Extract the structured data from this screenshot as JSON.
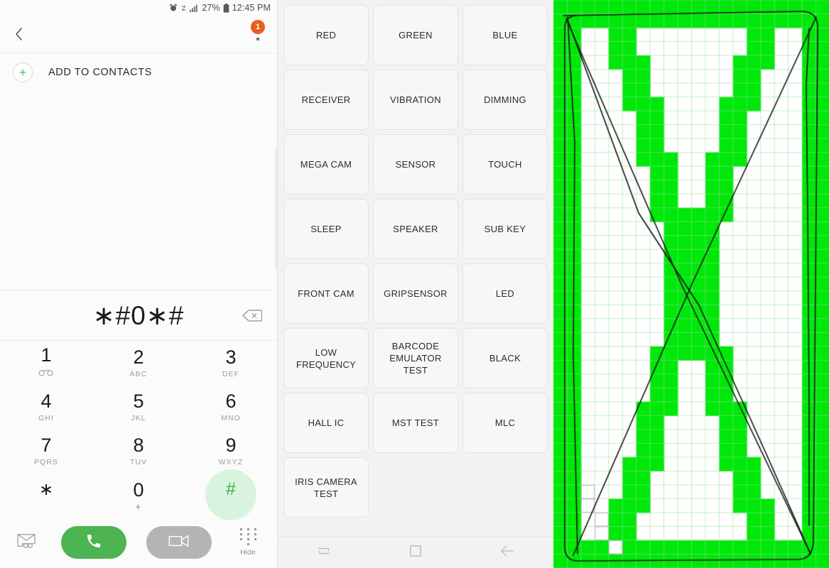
{
  "dialer": {
    "statusbar": {
      "icons": [
        "alarm-icon",
        "sync-icon",
        "signal-icon"
      ],
      "battery_percent": "27%",
      "battery_icon": "battery-icon",
      "time": "12:45 PM"
    },
    "appbar": {
      "back_icon": "chevron-left-icon",
      "badge_count": "1"
    },
    "add_to_contacts": {
      "icon": "plus-icon",
      "label": "ADD TO CONTACTS"
    },
    "number_display": {
      "value": "∗#0∗#",
      "backspace_icon": "backspace-icon"
    },
    "keypad": [
      {
        "digit": "1",
        "sub": "",
        "icon": "voicemail-icon",
        "pressed": false
      },
      {
        "digit": "2",
        "sub": "ABC",
        "icon": "",
        "pressed": false
      },
      {
        "digit": "3",
        "sub": "DEF",
        "icon": "",
        "pressed": false
      },
      {
        "digit": "4",
        "sub": "GHI",
        "icon": "",
        "pressed": false
      },
      {
        "digit": "5",
        "sub": "JKL",
        "icon": "",
        "pressed": false
      },
      {
        "digit": "6",
        "sub": "MNO",
        "icon": "",
        "pressed": false
      },
      {
        "digit": "7",
        "sub": "PQRS",
        "icon": "",
        "pressed": false
      },
      {
        "digit": "8",
        "sub": "TUV",
        "icon": "",
        "pressed": false
      },
      {
        "digit": "9",
        "sub": "WXYZ",
        "icon": "",
        "pressed": false
      },
      {
        "digit": "∗",
        "sub": "",
        "icon": "",
        "pressed": false
      },
      {
        "digit": "0",
        "sub": "+",
        "icon": "",
        "pressed": false
      },
      {
        "digit": "#",
        "sub": "",
        "icon": "",
        "pressed": true
      }
    ],
    "actions": {
      "message_icon": "message-icon",
      "call_icon": "phone-icon",
      "video_call_icon": "video-camera-icon",
      "hide_icon": "keypad-dots-icon",
      "hide_label": "Hide"
    }
  },
  "test_menu": {
    "items": [
      "RED",
      "GREEN",
      "BLUE",
      "RECEIVER",
      "VIBRATION",
      "DIMMING",
      "MEGA CAM",
      "SENSOR",
      "TOUCH",
      "SLEEP",
      "SPEAKER",
      "SUB KEY",
      "FRONT CAM",
      "GRIPSENSOR",
      "LED",
      "LOW FREQUENCY",
      "BARCODE EMULATOR TEST",
      "BLACK",
      "HALL IC",
      "MST TEST",
      "MLC",
      "IRIS CAMERA TEST"
    ],
    "navbar": {
      "recents_icon": "recents-icon",
      "home_icon": "home-square-icon",
      "back_icon": "back-arrow-icon"
    }
  },
  "touch_test": {
    "grid_color": "#00e80a",
    "grid_line_color": "#8fe08f",
    "trace_color": "#111111",
    "background": "#ffffff",
    "columns": 20,
    "rows": 41,
    "pattern": "border-plus-x-cross",
    "unfilled_cells": [
      [
        2,
        35
      ],
      [
        2,
        36
      ],
      [
        3,
        37
      ],
      [
        3,
        38
      ],
      [
        4,
        39
      ]
    ]
  }
}
